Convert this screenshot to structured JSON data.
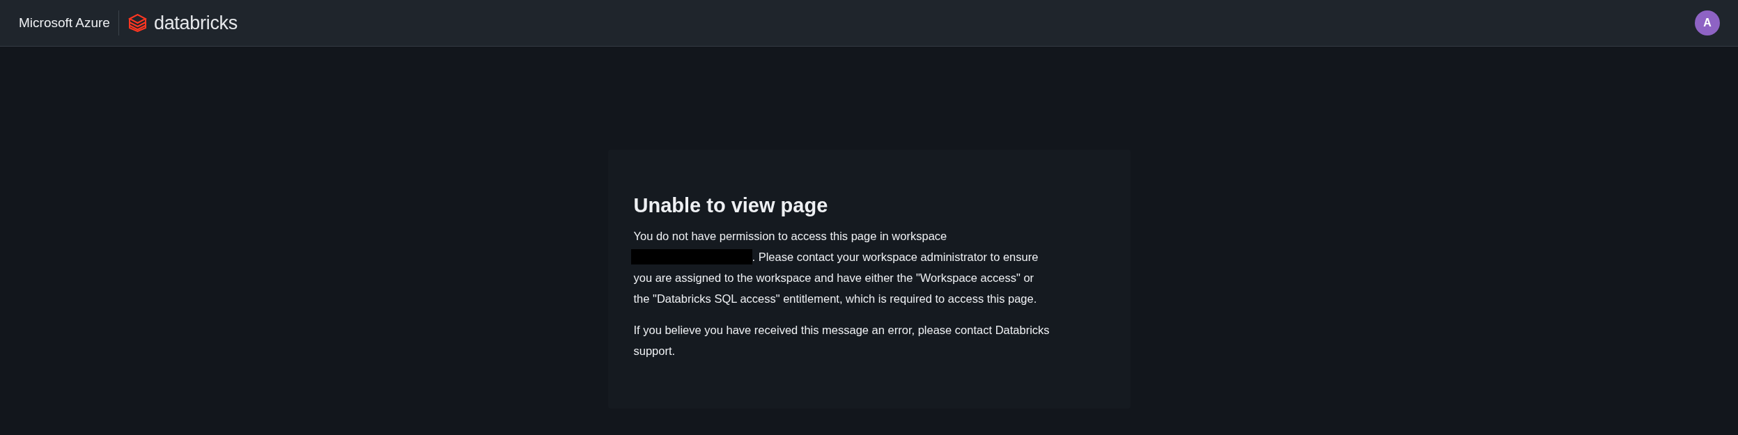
{
  "header": {
    "brand": "Microsoft Azure",
    "product": "databricks",
    "avatar": "A"
  },
  "card": {
    "title": "Unable to view page",
    "paragraphs": [
      {
        "lines": [
          [
            {
              "kind": "text",
              "text": "You do not have permission to access this page in workspace"
            }
          ],
          [
            {
              "kind": "redacted"
            },
            {
              "kind": "text",
              "text": ". Please contact your workspace administrator to ensure"
            }
          ],
          [
            {
              "kind": "text",
              "text": "you are assigned to the workspace and have either the \"Workspace access\" or"
            }
          ],
          [
            {
              "kind": "text",
              "text": "the \"Databricks SQL access\" entitlement, which is required to access this page."
            }
          ]
        ]
      },
      {
        "lines": [
          [
            {
              "kind": "text",
              "text": "If you believe you have received this message an error, please contact Databricks support."
            }
          ]
        ]
      }
    ]
  }
}
